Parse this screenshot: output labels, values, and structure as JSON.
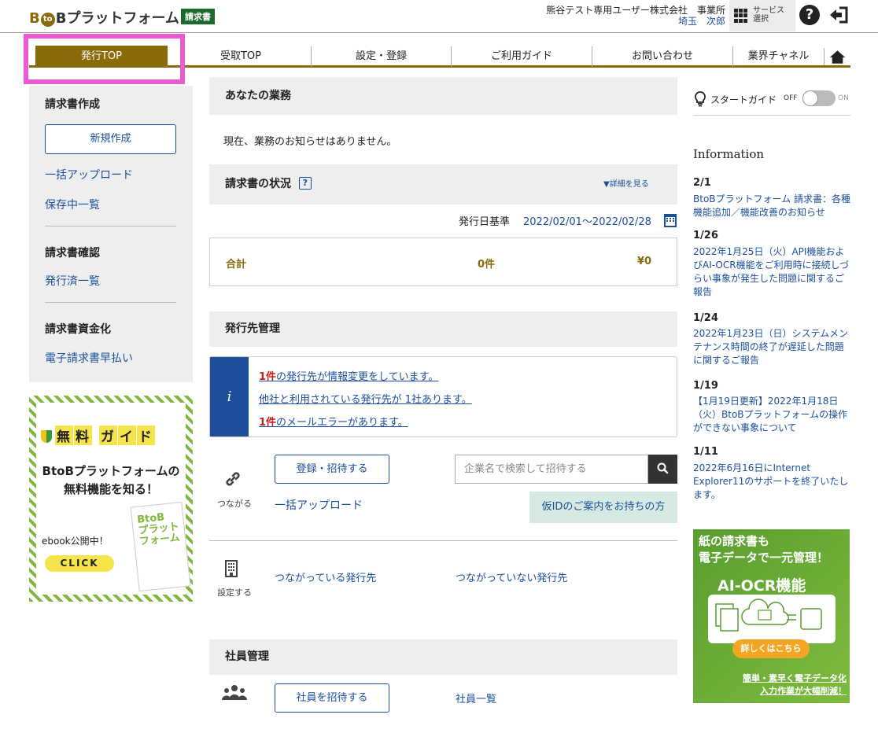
{
  "header": {
    "logo_text": "BtoBプラットフォーム",
    "logo_b": "B",
    "logo_to": "to",
    "logo_b2": "Bプラットフォーム",
    "logo_badge": "請求書",
    "company": "熊谷テスト専用ユーザー株式会社　事業所",
    "user": "埼玉　次郎",
    "service_label_1": "サービス",
    "service_label_2": "選択",
    "help_icon": "question-circle-icon",
    "logout_icon": "logout-icon"
  },
  "tabs": [
    {
      "label": "発行TOP",
      "active": true
    },
    {
      "label": "受取TOP"
    },
    {
      "label": "設定・登録"
    },
    {
      "label": "ご利用ガイド"
    },
    {
      "label": "お問い合わせ"
    },
    {
      "label": "業界チャネル"
    }
  ],
  "sidebar": {
    "sections": [
      {
        "heading": "請求書作成",
        "button": "新規作成",
        "links": [
          "一括アップロード",
          "保存中一覧"
        ]
      },
      {
        "heading": "請求書確認",
        "links": [
          "発行済一覧"
        ]
      },
      {
        "heading": "請求書資金化",
        "links": [
          "電子請求書早払い"
        ]
      }
    ]
  },
  "promo": {
    "title_chars": [
      "無",
      "料",
      "ガ",
      "イ",
      "ド"
    ],
    "sub_1": "BtoBプラットフォームの",
    "sub_2": "無料機能を知る！",
    "ebook": "ebook公開中！",
    "click": "CLICK",
    "book_title": "BtoB\nプラットフォーム"
  },
  "main": {
    "your_work": {
      "title": "あなたの業務",
      "message": "現在、業務のお知らせはありません。"
    },
    "invoice_status": {
      "title": "請求書の状況",
      "detail_link": "▼詳細を見る",
      "date_label": "発行日基準",
      "date_range": "2022/02/01〜2022/02/28",
      "total_label": "合計",
      "count": "0件",
      "amount": "¥0"
    },
    "destination": {
      "title": "発行先管理",
      "notices": [
        {
          "num": "1件",
          "text": "の発行先が情報変更をしています。"
        },
        {
          "num": "",
          "text": "他社と利用されている発行先が 1社あります。"
        },
        {
          "num": "1件",
          "text": "のメールエラーがあります。"
        }
      ],
      "connect_label": "つながる",
      "register_button": "登録・招待する",
      "bulk_upload": "一括アップロード",
      "search_placeholder": "企業名で検索して招待する",
      "temp_id_button": "仮IDのご案内をお持ちの方",
      "settings_label": "設定する",
      "connected": "つながっている発行先",
      "not_connected": "つながっていない発行先"
    },
    "staff": {
      "title": "社員管理",
      "invite_button": "社員を招待する",
      "list_link": "社員一覧"
    }
  },
  "right": {
    "guide": {
      "label": "スタートガイド",
      "off": "OFF",
      "on": "ON",
      "enabled": false
    },
    "info_title": "Information",
    "news": [
      {
        "date": "2/1",
        "text": "BtoBプラットフォーム 請求書：各種機能追加／機能改善のお知らせ"
      },
      {
        "date": "1/26",
        "text": "2022年1月25日（火）API機能およびAI-OCR機能をご利用時に接続しづらい事象が発生した問題に関するご報告"
      },
      {
        "date": "1/24",
        "text": "2022年1月23日（日）システムメンテナンス時間の終了が遅延した問題に関するご報告"
      },
      {
        "date": "1/19",
        "text": "【1月19日更新】2022年1月18日（火）BtoBプラットフォームの操作ができない事象について"
      },
      {
        "date": "1/11",
        "text": "2022年6月16日にInternet Explorer11のサポートを終了いたします。"
      }
    ],
    "ad": {
      "line1": "紙の請求書も",
      "line2": "電子データで一元管理！",
      "line3": "AI-OCR機能",
      "cta": "詳しくはこちら",
      "line4": "簡単・素早く電子データ化",
      "line5": "入力作業が大幅削減！"
    }
  }
}
